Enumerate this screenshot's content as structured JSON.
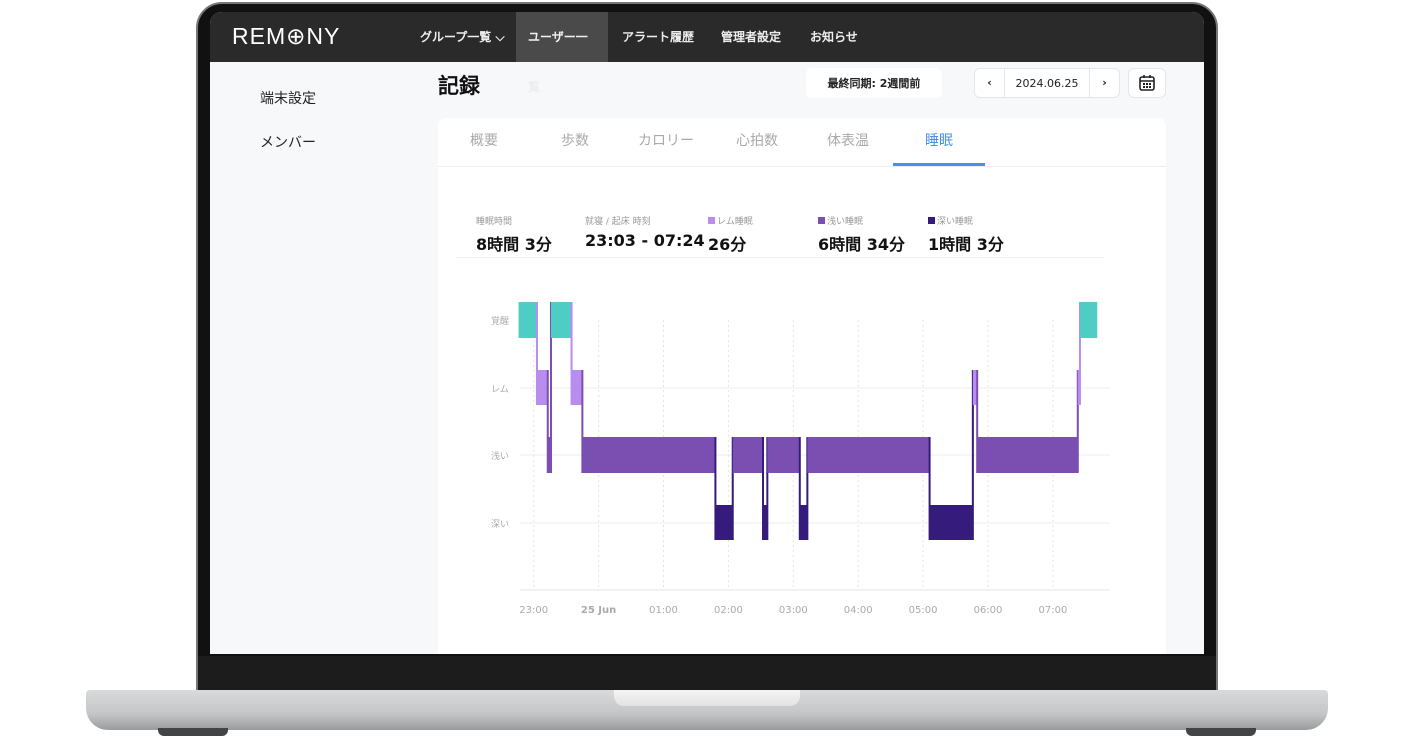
{
  "nav": {
    "logo": "REM⊕NY",
    "items": [
      {
        "label": "グループ一覧 ⌵"
      },
      {
        "label": "ユーザー一覧",
        "active": true
      },
      {
        "label": "アラート履歴"
      },
      {
        "label": "管理者設定"
      },
      {
        "label": "お知らせ"
      }
    ]
  },
  "sidebar": {
    "items": [
      {
        "label": "端末設定"
      },
      {
        "label": "メンバー"
      }
    ]
  },
  "page": {
    "title": "記録",
    "sync": "最終同期: 2週間前",
    "date": "2024.06.25",
    "prev": "‹",
    "next": "›",
    "calendar_icon": "calendar-icon"
  },
  "tabs": [
    {
      "label": "概要"
    },
    {
      "label": "歩数"
    },
    {
      "label": "カロリー"
    },
    {
      "label": "心拍数"
    },
    {
      "label": "体表温"
    },
    {
      "label": "睡眠",
      "active": true
    }
  ],
  "stats": [
    {
      "label": "睡眠時間",
      "value": "8時間 3分"
    },
    {
      "label": "就寝 / 起床 時刻",
      "value": "23:03 - 07:24"
    },
    {
      "label": "レム睡眠",
      "value": "26分",
      "color": "#b98cf0"
    },
    {
      "label": "浅い睡眠",
      "value": "6時間 34分",
      "color": "#7b4fb2"
    },
    {
      "label": "深い睡眠",
      "value": "1時間 3分",
      "color": "#351c7c"
    }
  ],
  "colors": {
    "awake": "#4ecdc4",
    "rem": "#b98cf0",
    "light": "#7b4fb2",
    "deep": "#351c7c",
    "accent": "#4a8fe8"
  },
  "chart_data": {
    "type": "step-area",
    "y_categories": [
      "覚醒",
      "レム",
      "浅い",
      "深い"
    ],
    "x_ticks": [
      "23:00",
      "25 Jun",
      "01:00",
      "02:00",
      "03:00",
      "04:00",
      "05:00",
      "06:00",
      "07:00"
    ],
    "grid": true,
    "segments": [
      {
        "stage": "覚醒",
        "start": "22:46",
        "end": "23:03"
      },
      {
        "stage": "レム",
        "start": "23:03",
        "end": "23:13"
      },
      {
        "stage": "浅い",
        "start": "23:13",
        "end": "23:16"
      },
      {
        "stage": "覚醒",
        "start": "23:16",
        "end": "23:35"
      },
      {
        "stage": "レム",
        "start": "23:35",
        "end": "23:45"
      },
      {
        "stage": "浅い",
        "start": "23:45",
        "end": "01:48"
      },
      {
        "stage": "深い",
        "start": "01:48",
        "end": "02:04"
      },
      {
        "stage": "浅い",
        "start": "02:04",
        "end": "02:32"
      },
      {
        "stage": "深い",
        "start": "02:32",
        "end": "02:36"
      },
      {
        "stage": "浅い",
        "start": "02:36",
        "end": "03:06"
      },
      {
        "stage": "深い",
        "start": "03:06",
        "end": "03:13"
      },
      {
        "stage": "浅い",
        "start": "03:13",
        "end": "05:06"
      },
      {
        "stage": "深い",
        "start": "05:06",
        "end": "05:46"
      },
      {
        "stage": "レム",
        "start": "05:46",
        "end": "05:50"
      },
      {
        "stage": "浅い",
        "start": "05:50",
        "end": "07:23"
      },
      {
        "stage": "レム",
        "start": "07:23",
        "end": "07:25"
      },
      {
        "stage": "覚醒",
        "start": "07:25",
        "end": "07:41"
      }
    ]
  }
}
